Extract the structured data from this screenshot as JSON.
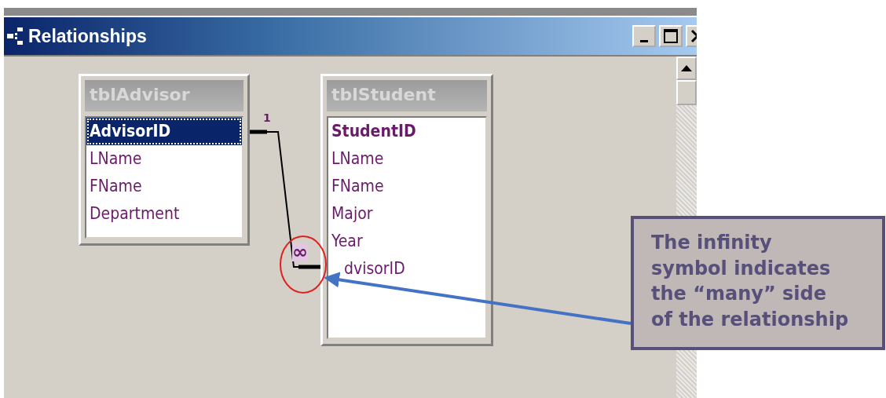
{
  "window": {
    "title": "Relationships"
  },
  "tables": [
    {
      "title": "tblAdvisor",
      "fields": [
        {
          "name": "AdvisorID",
          "primary_key": true,
          "selected": true
        },
        {
          "name": "LName",
          "primary_key": false,
          "selected": false
        },
        {
          "name": "FName",
          "primary_key": false,
          "selected": false
        },
        {
          "name": "Department",
          "primary_key": false,
          "selected": false
        }
      ]
    },
    {
      "title": "tblStudent",
      "fields": [
        {
          "name": "StudentID",
          "primary_key": true,
          "selected": false
        },
        {
          "name": "LName",
          "primary_key": false,
          "selected": false
        },
        {
          "name": "FName",
          "primary_key": false,
          "selected": false
        },
        {
          "name": "Major",
          "primary_key": false,
          "selected": false
        },
        {
          "name": "Year",
          "primary_key": false,
          "selected": false
        },
        {
          "name": "dvisorID",
          "primary_key": false,
          "selected": false
        }
      ]
    }
  ],
  "relationship": {
    "one_label": "1",
    "many_label": "∞"
  },
  "callout": {
    "text": "The infinity\nsymbol indicates\nthe “many” side\nof the relationship"
  }
}
